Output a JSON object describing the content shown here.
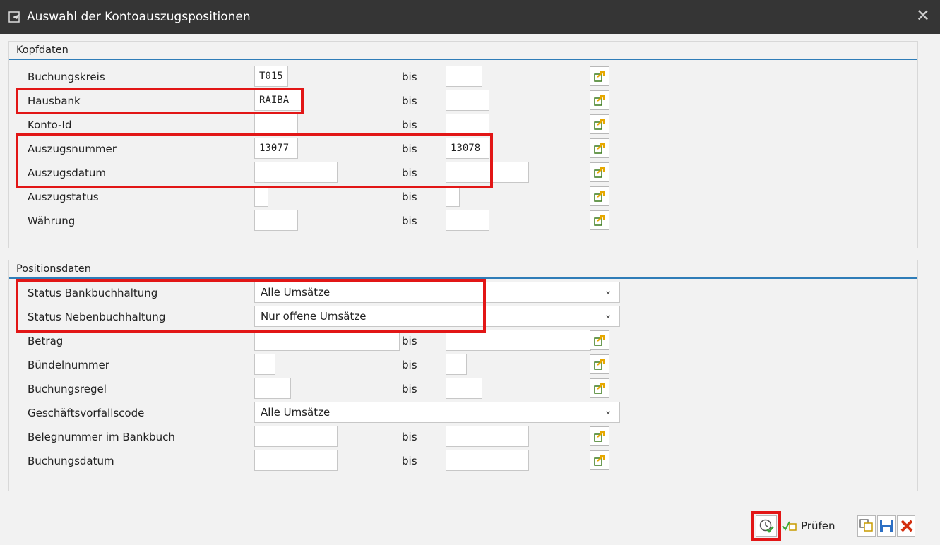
{
  "window": {
    "title": "Auswahl der Kontoauszugspositionen",
    "close": "✕"
  },
  "kopfdaten": {
    "title": "Kopfdaten",
    "bis_label": "bis",
    "rows": [
      {
        "label": "Buchungskreis",
        "from": "T015",
        "to": ""
      },
      {
        "label": "Hausbank",
        "from": "RAIBA",
        "to": ""
      },
      {
        "label": "Konto-Id",
        "from": "",
        "to": ""
      },
      {
        "label": "Auszugsnummer",
        "from": "13077",
        "to": "13078"
      },
      {
        "label": "Auszugsdatum",
        "from": "",
        "to": ""
      },
      {
        "label": "Auszugstatus",
        "from": "",
        "to": ""
      },
      {
        "label": "Währung",
        "from": "",
        "to": ""
      }
    ]
  },
  "positionsdaten": {
    "title": "Positionsdaten",
    "bis_label": "bis",
    "status_bank": {
      "label": "Status Bankbuchhaltung",
      "value": "Alle Umsätze"
    },
    "status_neben": {
      "label": "Status Nebenbuchhaltung",
      "value": "Nur offene Umsätze"
    },
    "betrag": {
      "label": "Betrag",
      "from": "",
      "to": ""
    },
    "buendel": {
      "label": "Bündelnummer",
      "from": "",
      "to": ""
    },
    "regel": {
      "label": "Buchungsregel",
      "from": "",
      "to": ""
    },
    "gvc": {
      "label": "Geschäftsvorfallscode",
      "value": "Alle Umsätze"
    },
    "beleg": {
      "label": "Belegnummer im Bankbuch",
      "from": "",
      "to": ""
    },
    "datum": {
      "label": "Buchungsdatum",
      "from": "",
      "to": ""
    }
  },
  "footer": {
    "pruefen_label": "Prüfen"
  },
  "colors": {
    "accent": "#2f7db8",
    "highlight": "#e21616",
    "titlebar": "#353535"
  }
}
